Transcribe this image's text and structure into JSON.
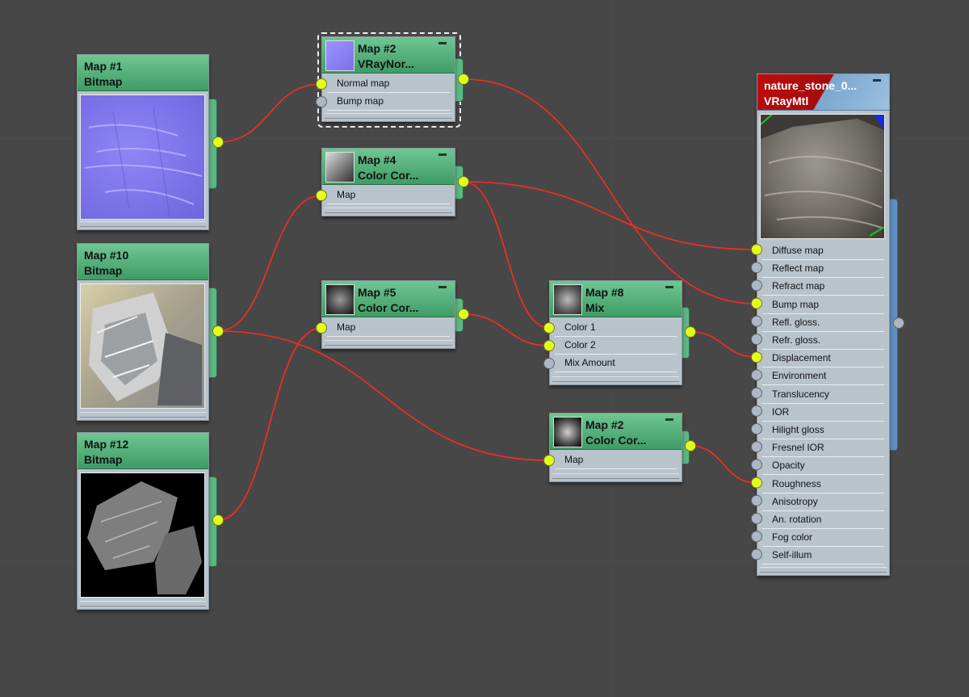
{
  "colors": {
    "background": "#474747",
    "node_body": "#b9c3cc",
    "node_header": "#4fae76",
    "material_header": "#b50e0e",
    "material_header_alt": "#7aa6cf",
    "wire": "#ff2a1e",
    "socket_connected": "#e1ff1e",
    "socket_empty": "#aeb8c4"
  },
  "nodes": {
    "map1": {
      "title": "Map #1",
      "subtitle": "Bitmap",
      "thumb_icon": "normal-map-texture"
    },
    "map10": {
      "title": "Map #10",
      "subtitle": "Bitmap",
      "thumb_icon": "stone-texture"
    },
    "map12": {
      "title": "Map #12",
      "subtitle": "Bitmap",
      "thumb_icon": "roughness-texture"
    },
    "normal": {
      "title": "Map #2",
      "subtitle": "VRayNor...",
      "sockets": [
        "Normal map",
        "Bump map"
      ]
    },
    "cc4": {
      "title": "Map #4",
      "subtitle": "Color Cor...",
      "sockets": [
        "Map"
      ]
    },
    "cc5": {
      "title": "Map #5",
      "subtitle": "Color Cor...",
      "sockets": [
        "Map"
      ]
    },
    "mix8": {
      "title": "Map #8",
      "subtitle": "Mix",
      "sockets": [
        "Color 1",
        "Color 2",
        "Mix Amount"
      ]
    },
    "cc2": {
      "title": "Map #2",
      "subtitle": "Color Cor...",
      "sockets": [
        "Map"
      ]
    },
    "material": {
      "title": "nature_stone_0...",
      "subtitle": "VRayMtl",
      "sockets": [
        "Diffuse map",
        "Reflect map",
        "Refract map",
        "Bump map",
        "Refl. gloss.",
        "Refr. gloss.",
        "Displacement",
        "Environment",
        "Translucency",
        "IOR",
        "Hilight gloss",
        "Fresnel IOR",
        "Opacity",
        "Roughness",
        "Anisotropy",
        "An. rotation",
        "Fog color",
        "Self-illum"
      ],
      "connected": [
        "Diffuse map",
        "Bump map",
        "Displacement",
        "Roughness"
      ]
    }
  }
}
